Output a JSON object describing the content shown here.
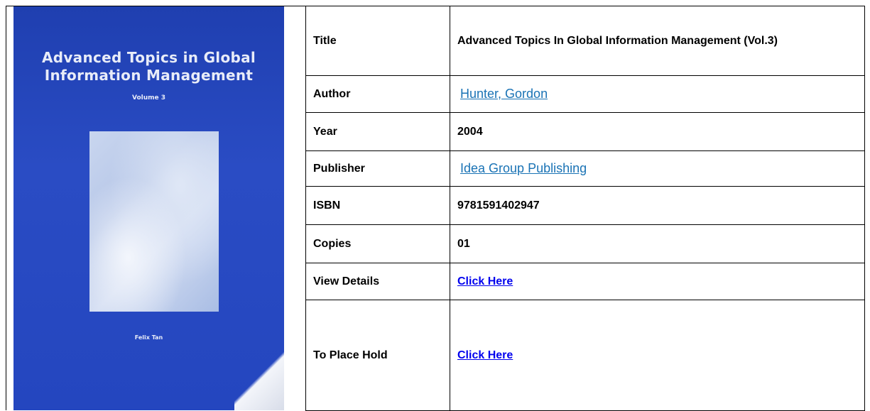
{
  "book": {
    "cover": {
      "title": "Advanced Topics in Global Information Management",
      "volume": "Volume 3",
      "author": "Felix Tan"
    },
    "rows": [
      {
        "label": "Title",
        "value": "Advanced Topics In Global Information Management (Vol.3)"
      },
      {
        "label": "Author",
        "value": "Hunter, Gordon"
      },
      {
        "label": "Year",
        "value": "2004"
      },
      {
        "label": "Publisher",
        "value": "Idea Group Publishing"
      },
      {
        "label": "ISBN",
        "value": "9781591402947"
      },
      {
        "label": "Copies",
        "value": "01"
      },
      {
        "label": "View Details",
        "value": "Click Here"
      },
      {
        "label": "To Place Hold",
        "value": "Click Here"
      }
    ]
  },
  "colors": {
    "cover_blue": "#2446bf",
    "author_link": "#1a73b5",
    "click_link": "#0000ee"
  }
}
